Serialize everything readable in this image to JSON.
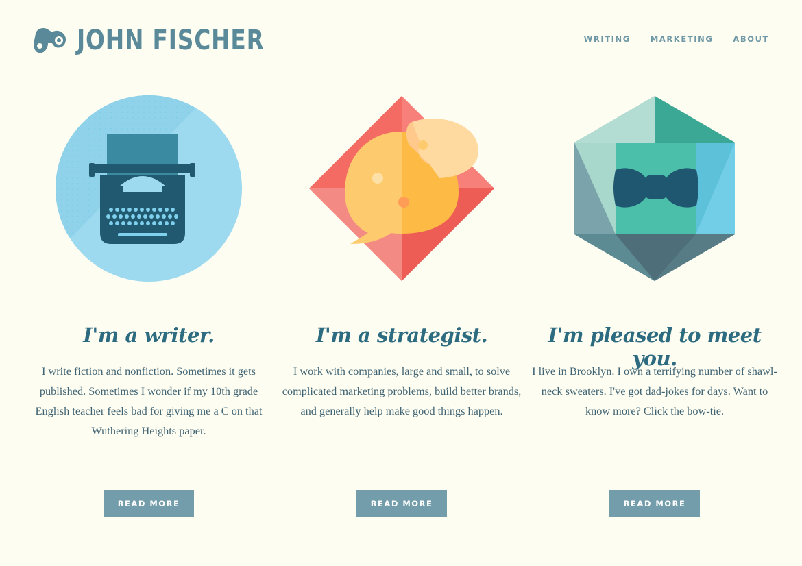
{
  "brand": {
    "name": "JOHN FISCHER",
    "icon": "binoculars-icon",
    "color": "#5a8a99"
  },
  "nav": {
    "items": [
      "WRITING",
      "MARKETING",
      "ABOUT"
    ]
  },
  "columns": [
    {
      "icon": "typewriter-icon",
      "heading": "I'm a writer.",
      "text": "I write fiction and nonfiction. Sometimes it gets published. Sometimes I wonder if my 10th grade English teacher feels bad for giving me a C on that Wuthering Heights paper.",
      "button": "READ MORE"
    },
    {
      "icon": "speech-bubble-puzzle-icon",
      "heading": "I'm a strategist.",
      "text": "I work with companies, large and small, to solve complicated marketing problems, build better brands, and generally help make good things happen.",
      "button": "READ MORE"
    },
    {
      "icon": "bow-tie-gem-icon",
      "heading": "I'm pleased to meet you.",
      "text": "I live in Brooklyn. I own a terrifying number of shawl-neck sweaters. I've got dad-jokes for days. Want to know more? Click the bow-tie.",
      "button": "READ MORE"
    }
  ],
  "colors": {
    "background": "#fefdf1",
    "heading": "#2d6b81",
    "button": "#739dab"
  }
}
